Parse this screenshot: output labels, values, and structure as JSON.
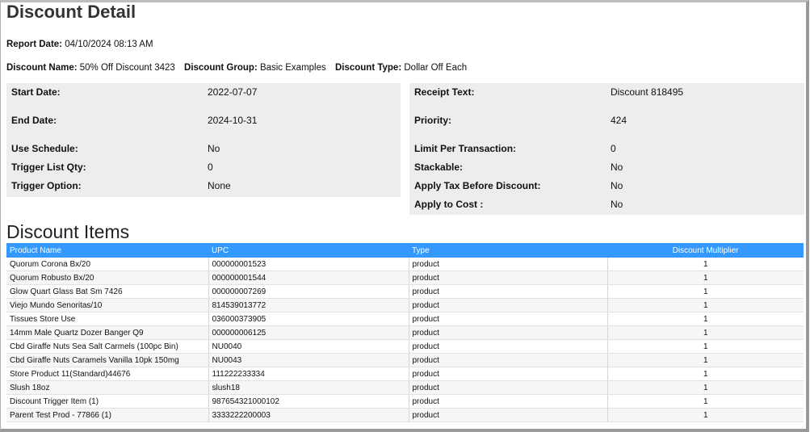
{
  "header": {
    "title": "Discount Detail"
  },
  "report": {
    "date_label": "Report Date:",
    "date_value": "04/10/2024 08:13 AM"
  },
  "summary": {
    "name_label": "Discount Name:",
    "name_value": "50% Off Discount 3423",
    "group_label": "Discount Group:",
    "group_value": "Basic Examples",
    "type_label": "Discount Type:",
    "type_value": "Dollar Off Each"
  },
  "left_panel": [
    {
      "label": "Start Date:",
      "value": "2022-07-07"
    },
    {
      "label": "End Date:",
      "value": "2024-10-31"
    },
    {
      "label": "Use Schedule:",
      "value": "No"
    },
    {
      "label": "Trigger List Qty:",
      "value": "0"
    },
    {
      "label": "Trigger Option:",
      "value": "None"
    }
  ],
  "right_panel": [
    {
      "label": "Receipt Text:",
      "value": "Discount 818495"
    },
    {
      "label": "Priority:",
      "value": "424"
    },
    {
      "label": "Limit Per Transaction:",
      "value": "0"
    },
    {
      "label": "Stackable:",
      "value": "No"
    },
    {
      "label": "Apply Tax Before Discount:",
      "value": "No"
    },
    {
      "label": "Apply to Cost :",
      "value": "No"
    }
  ],
  "items": {
    "title": "Discount Items",
    "columns": [
      "Product Name",
      "UPC",
      "Type",
      "Discount Multiplier"
    ],
    "rows": [
      [
        "Quorum Corona Bx/20",
        "000000001523",
        "product",
        "1"
      ],
      [
        "Quorum Robusto Bx/20",
        "000000001544",
        "product",
        "1"
      ],
      [
        "Glow Quart Glass Bat Sm 7426",
        "000000007269",
        "product",
        "1"
      ],
      [
        "Viejo Mundo Senoritas/10",
        "814539013772",
        "product",
        "1"
      ],
      [
        "Tissues Store Use",
        "036000373905",
        "product",
        "1"
      ],
      [
        "14mm Male Quartz Dozer Banger Q9",
        "000000006125",
        "product",
        "1"
      ],
      [
        "Cbd Giraffe Nuts Sea Salt Carmels (100pc Bin)",
        "NU0040",
        "product",
        "1"
      ],
      [
        "Cbd Giraffe Nuts  Caramels Vanilla 10pk 150mg",
        "NU0043",
        "product",
        "1"
      ],
      [
        "Store Product 11(Standard)44676",
        "111222233334",
        "product",
        "1"
      ],
      [
        "Slush 18oz",
        "slush18",
        "product",
        "1"
      ],
      [
        "Discount Trigger Item (1)",
        "987654321000102",
        "product",
        "1"
      ],
      [
        "Parent Test Prod - 77866 (1)",
        "3333222200003",
        "product",
        "1"
      ]
    ]
  },
  "colors": {
    "table_header": "#3399ff",
    "panel_bg": "#ededed"
  }
}
